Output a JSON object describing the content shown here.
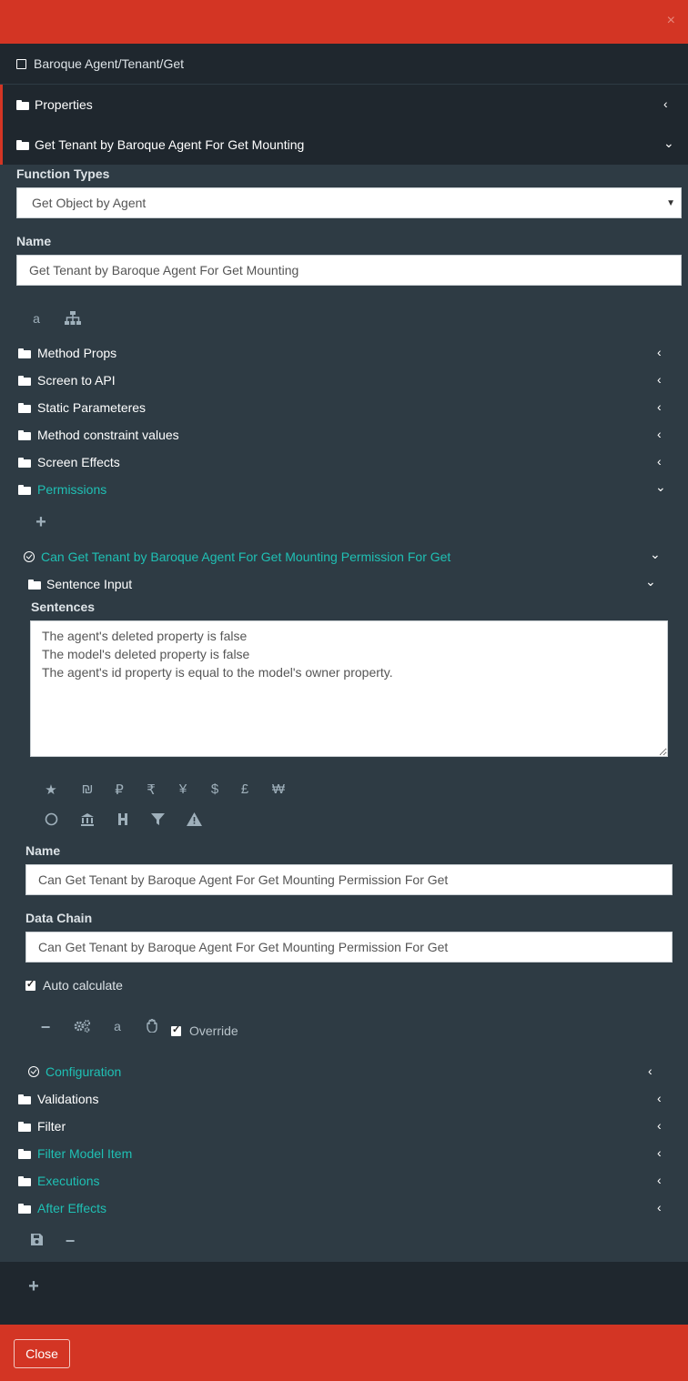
{
  "window": {
    "close_icon": "×"
  },
  "breadcrumb": "Baroque Agent/Tenant/Get",
  "panels": {
    "properties": "Properties",
    "method": "Get Tenant by Baroque Agent For Get Mounting"
  },
  "form": {
    "function_types_label": "Function Types",
    "function_type_value": "Get Object by Agent",
    "name_label": "Name",
    "name_value": "Get Tenant by Baroque Agent For Get Mounting"
  },
  "sections": [
    "Method Props",
    "Screen to API",
    "Static Parameteres",
    "Method constraint values",
    "Screen Effects",
    "Permissions"
  ],
  "permission": {
    "title": "Can Get Tenant by Baroque Agent For Get Mounting Permission For Get",
    "sentence_input": "Sentence Input",
    "sentences_label": "Sentences",
    "sentences": "The agent's deleted property is false\nThe model's deleted property is false\nThe agent's id property is equal to the model's owner property.",
    "currency_icons": [
      "★",
      "₪",
      "₽",
      "₹",
      "¥",
      "$",
      "£",
      "₩"
    ],
    "name_label": "Name",
    "name_value": "Can Get Tenant by Baroque Agent For Get Mounting Permission For Get",
    "data_chain_label": "Data Chain",
    "data_chain_value": "Can Get Tenant by Baroque Agent For Get Mounting Permission For Get",
    "auto_calculate": "Auto calculate",
    "override": "Override",
    "configuration": "Configuration"
  },
  "lower_sections": [
    "Validations",
    "Filter",
    "Filter Model Item",
    "Executions",
    "After Effects"
  ],
  "footer": {
    "close": "Close"
  },
  "colors": {
    "accent": "#d33524",
    "teal": "#1fc0b4",
    "panel": "#2e3b44",
    "dark": "#1f272e"
  }
}
